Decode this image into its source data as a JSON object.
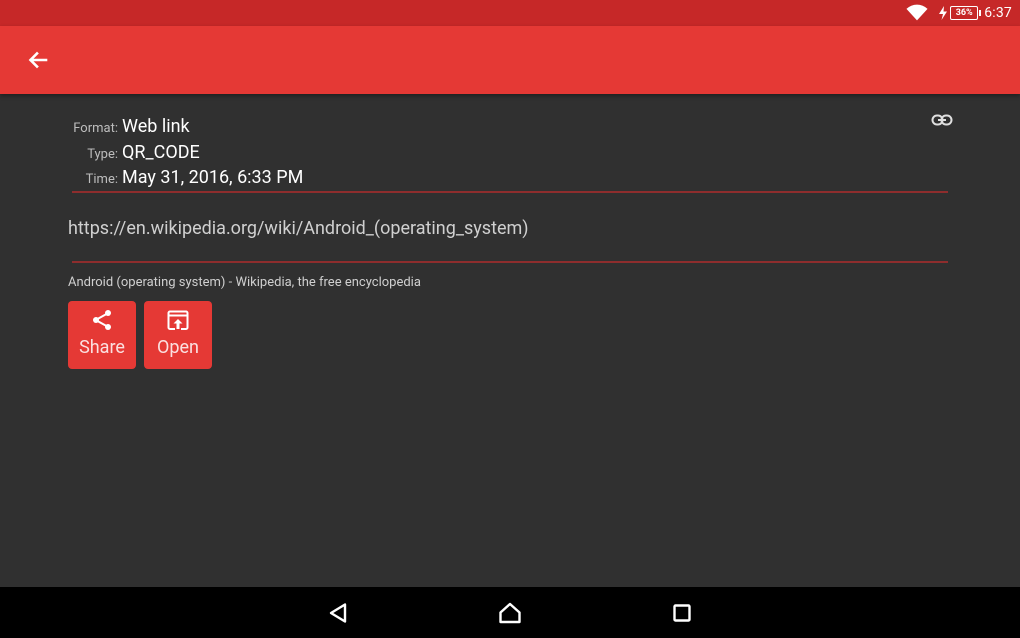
{
  "status_bar": {
    "battery_level": "36%",
    "time": "6:37",
    "icons": [
      "wifi-icon",
      "charging-bolt-icon",
      "battery-icon"
    ]
  },
  "app_bar": {
    "back_icon": "arrow-back-icon",
    "color": "#E53935"
  },
  "details": {
    "format_label": "Format:",
    "format_value": "Web link",
    "type_label": "Type:",
    "type_value": "QR_CODE",
    "time_label": "Time:",
    "time_value": "May 31, 2016, 6:33 PM",
    "link_icon": "link-icon"
  },
  "url": "https://en.wikipedia.org/wiki/Android_(operating_system)",
  "page_title": "Android (operating system) - Wikipedia, the free encyclopedia",
  "actions": [
    {
      "label": "Share",
      "icon": "share-icon"
    },
    {
      "label": "Open",
      "icon": "open-in-browser-icon"
    }
  ],
  "nav_bar": {
    "icons": [
      "nav-back-icon",
      "nav-home-icon",
      "nav-recents-icon"
    ]
  },
  "colors": {
    "status_bar": "#C62828",
    "app_bar": "#E53935",
    "background": "#303030",
    "divider": "#8E2D2D",
    "nav_bar": "#000000"
  }
}
